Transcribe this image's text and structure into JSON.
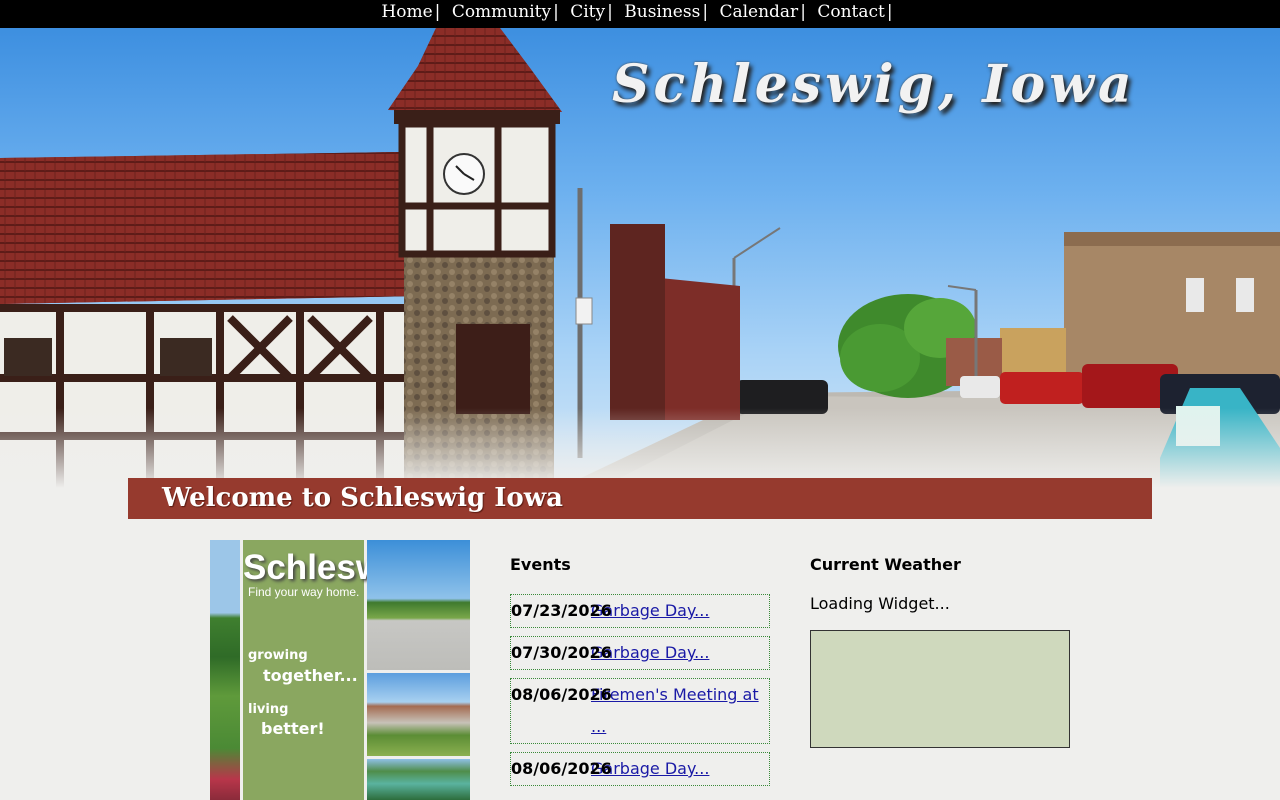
{
  "nav": {
    "items": [
      {
        "label": "Home",
        "sep": "|"
      },
      {
        "label": "Community",
        "sep": "|"
      },
      {
        "label": "City",
        "sep": "|"
      },
      {
        "label": "Business",
        "sep": "|"
      },
      {
        "label": "Calendar",
        "sep": "|"
      },
      {
        "label": "Contact",
        "sep": "|"
      }
    ]
  },
  "hero": {
    "title": "Schleswig, Iowa"
  },
  "welcome": {
    "text": "Welcome to Schleswig Iowa"
  },
  "promo": {
    "brand": "Schleswig",
    "tagline": "Find your way home.",
    "line1a": "growing",
    "line1b": "together...",
    "line2a": "living",
    "line2b": "better!"
  },
  "events": {
    "heading": "Events",
    "items": [
      {
        "date": "07/23/2026",
        "title": "Garbage Day..."
      },
      {
        "date": "07/30/2026",
        "title": "Garbage Day..."
      },
      {
        "date": "08/06/2026",
        "title": "Firemen's Meeting at ..."
      },
      {
        "date": "08/06/2026",
        "title": "Garbage Day..."
      }
    ]
  },
  "weather": {
    "heading": "Current Weather",
    "status": "Loading Widget..."
  },
  "colors": {
    "nav_bg": "#000000",
    "banner_red": "#963a2e",
    "promo_green": "#8aa760",
    "event_border": "#3a8a3a",
    "link_blue": "#1a1aa6",
    "weather_box": "#cfd9bd",
    "page_bg": "#efefed"
  }
}
